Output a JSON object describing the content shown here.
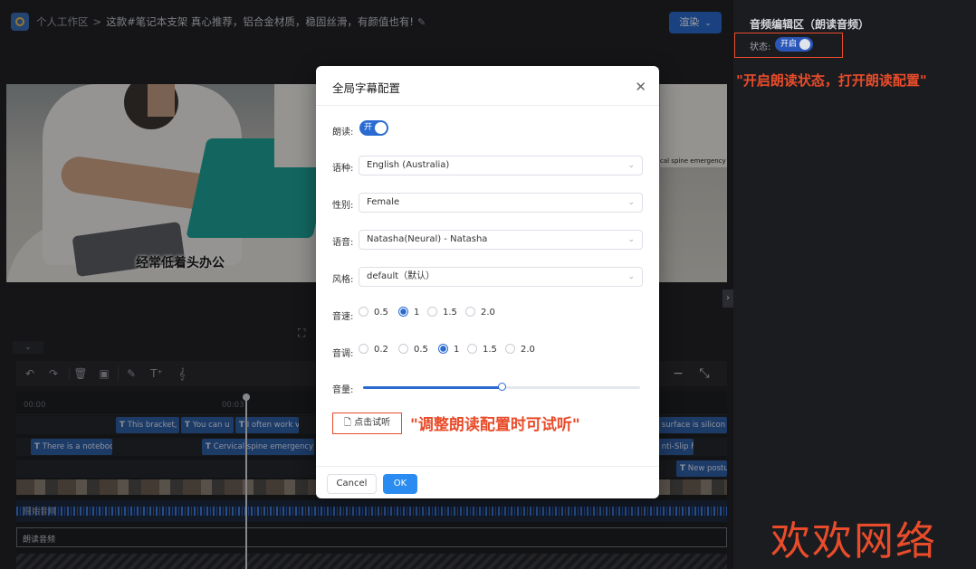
{
  "header": {
    "breadcrumb_root": "个人工作区",
    "separator": ">",
    "project_title": "这款#笔记本支架 真心推荐，铝合金材质，稳固丝滑，有颜值也有!",
    "render_label": "渲染"
  },
  "right_panel": {
    "title": "音频编辑区（朗读音频）",
    "status_label": "状态:",
    "toggle_label": "开启",
    "annotation": "\"开启朗读状态，打开朗读配置\""
  },
  "video": {
    "subtitle": "经常低着头办公",
    "panel_caption": "cal spine emergency"
  },
  "modal": {
    "title": "全局字幕配置",
    "read_label": "朗读:",
    "read_toggle": "开",
    "language_label": "语种:",
    "language_value": "English (Australia)",
    "gender_label": "性别:",
    "gender_value": "Female",
    "voice_label": "语音:",
    "voice_value": "Natasha(Neural) - Natasha",
    "style_label": "风格:",
    "style_value": "default（默认）",
    "speed_label": "音速:",
    "speed_options": [
      "0.5",
      "1",
      "1.5",
      "2.0"
    ],
    "speed_selected": "1",
    "pitch_label": "音调:",
    "pitch_options": [
      "0.2",
      "0.5",
      "1",
      "1.5",
      "2.0"
    ],
    "pitch_selected": "1",
    "volume_label": "音量:",
    "volume_level": 0.5,
    "preview_label": "点击试听",
    "preview_annotation": "\"调整朗读配置时可试听\"",
    "cancel_label": "Cancel",
    "ok_label": "OK"
  },
  "timeline": {
    "ticks": [
      "00:00",
      "00:03"
    ],
    "text_track_1": [
      "This bracket,",
      "You can u",
      "I often work v",
      "surface is silicon"
    ],
    "text_track_2": [
      "There is a noteboo",
      "Cervical spine emergency",
      "nti-Slip F"
    ],
    "text_track_3": [
      "New postu"
    ],
    "original_audio_label": "原始音频",
    "tts_audio_label": "朗读音频"
  },
  "watermark": "欢欢网络",
  "colors": {
    "accent": "#2a6bd1",
    "annotation": "#e84c2a",
    "ok": "#2a8cf0"
  }
}
